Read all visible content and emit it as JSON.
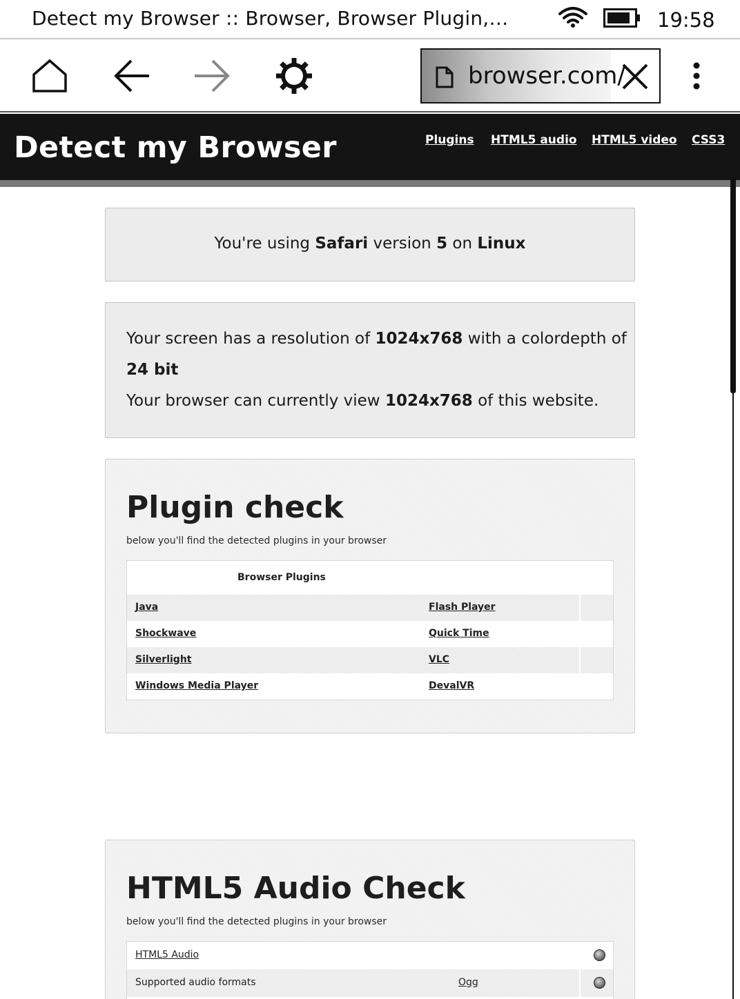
{
  "status_bar": {
    "page_title": "Detect my Browser :: Browser, Browser Plugin,…",
    "time": "19:58",
    "icons": [
      "wifi-icon",
      "battery-icon"
    ]
  },
  "toolbar": {
    "icons": [
      "home-icon",
      "back-arrow-icon",
      "forward-arrow-icon",
      "settings-gear-icon",
      "more-vertical-icon"
    ],
    "url": "browser.com/",
    "url_icon": "document-icon",
    "clear_icon": "close-icon"
  },
  "site": {
    "brand": "Detect my Browser",
    "nav": [
      "Plugins",
      "HTML5 audio",
      "HTML5 video",
      "CSS3"
    ]
  },
  "browser_info": {
    "prefix": "You're using ",
    "browser": "Safari",
    "mid1": " version ",
    "version": "5",
    "mid2": " on ",
    "os": "Linux"
  },
  "screen_info": {
    "l1_prefix": "Your screen has a resolution of ",
    "resolution": "1024x768",
    "l1_mid": " with a colordepth of",
    "colordepth": "24 bit",
    "l2_prefix": "Your browser can currently view ",
    "viewport": "1024x768",
    "l2_suffix": " of this website."
  },
  "plugin_check": {
    "title": "Plugin check",
    "subtitle": "below you'll find the detected plugins in your browser",
    "table_header": "Browser Plugins",
    "rows": [
      [
        "Java",
        "Flash Player"
      ],
      [
        "Shockwave",
        "Quick Time"
      ],
      [
        "Silverlight",
        "VLC"
      ],
      [
        "Windows Media Player",
        "DevalVR"
      ]
    ]
  },
  "audio_check": {
    "title": "HTML5 Audio Check",
    "subtitle": "below you'll find the detected plugins in your browser",
    "rows": [
      {
        "label": "HTML5 Audio",
        "value": "",
        "status_icon": "status-dot-icon"
      },
      {
        "label": "Supported audio formats",
        "value": "Ogg",
        "status_icon": "status-dot-icon"
      }
    ]
  }
}
